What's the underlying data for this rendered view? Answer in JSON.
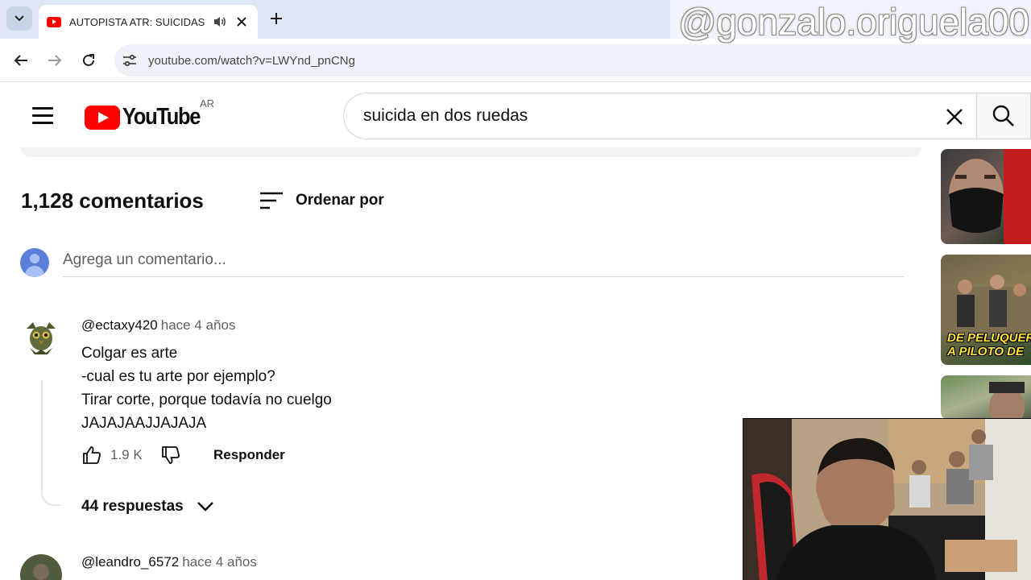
{
  "browser": {
    "tab": {
      "title": "AUTOPISTA ATR: SUICIDAS EN DOS RUEDAS"
    },
    "address_bar": {
      "url": "youtube.com/watch?v=LWYnd_pnCNg"
    }
  },
  "watermark": {
    "text": "@gonzalo.origuela00"
  },
  "youtube": {
    "logo_text": "YouTube",
    "country_code": "AR",
    "search": {
      "value": "suicida en dos ruedas"
    }
  },
  "comments_section": {
    "count_label": "1,128 comentarios",
    "sort_label": "Ordenar por",
    "add_placeholder": "Agrega un comentario..."
  },
  "comments": [
    {
      "author": "@ectaxy420",
      "time": "hace 4 años",
      "lines": [
        "Colgar es arte",
        "-cual es tu arte por ejemplo?",
        "Tirar corte, porque todavía no cuelgo",
        "JAJAJAAJJAJAJA"
      ],
      "likes": "1.9 K",
      "reply_label": "Responder",
      "replies_label": "44 respuestas"
    },
    {
      "author": "@leandro_6572",
      "time": "hace 4 años"
    }
  ],
  "sidebar": {
    "thumbnails": [
      {
        "caption": ""
      },
      {
        "caption": "DE PELUQUER\nA PILOTO DE"
      },
      {
        "caption": ""
      }
    ]
  },
  "colors": {
    "youtube_red": "#ff0000",
    "tabstrip": "#dfe6f3",
    "text_primary": "#0f0f0f",
    "text_secondary": "#606060"
  }
}
